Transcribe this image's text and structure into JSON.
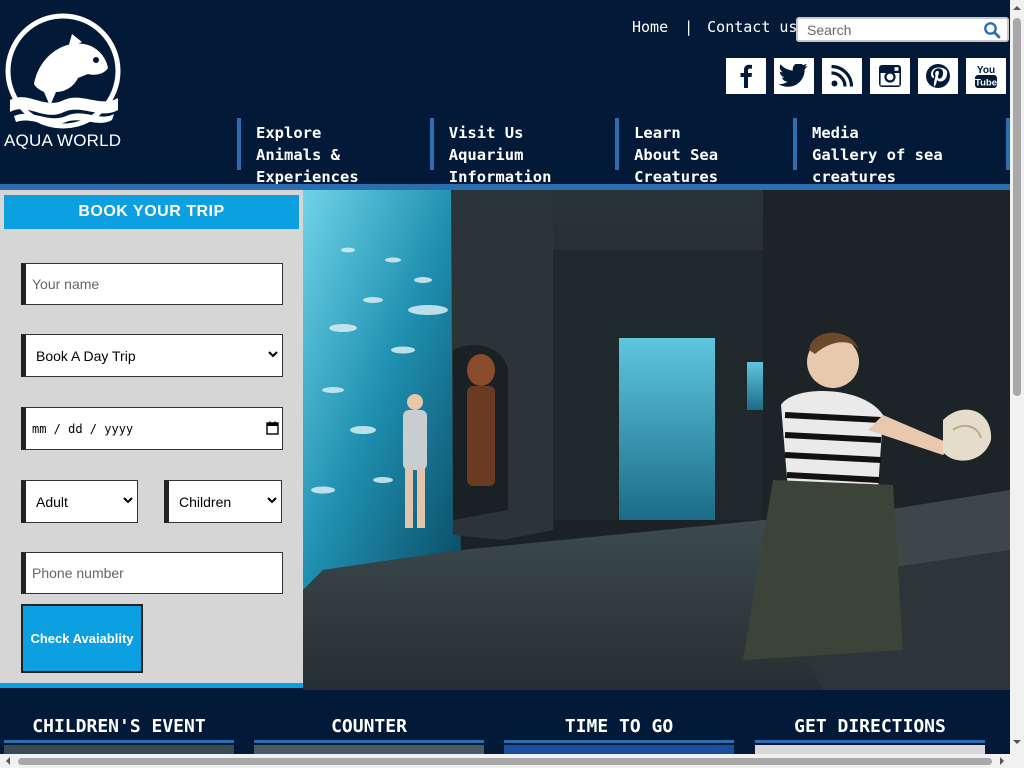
{
  "brand": {
    "name": "AQUA WORLD"
  },
  "toplinks": {
    "home": "Home",
    "separator": "|",
    "contact": "Contact us"
  },
  "search": {
    "placeholder": "Search",
    "icon": "search-icon"
  },
  "social": [
    "facebook-icon",
    "twitter-icon",
    "rss-icon",
    "instagram-icon",
    "pinterest-icon",
    "youtube-icon"
  ],
  "nav": [
    {
      "line1": "Explore",
      "line2": "Animals & Experiences"
    },
    {
      "line1": "Visit Us",
      "line2": "Aquarium Information"
    },
    {
      "line1": "Learn",
      "line2": "About Sea Creatures"
    },
    {
      "line1": "Media",
      "line2": "Gallery of sea creatures"
    }
  ],
  "booking": {
    "title": "BOOK YOUR TRIP",
    "name_placeholder": "Your name",
    "trip_selected": "Book A Day Trip",
    "date_placeholder": "mm / dd / yyyy",
    "adult_selected": "Adult",
    "children_selected": "Children",
    "phone_placeholder": "Phone number",
    "submit_label": "Check Avaiablity"
  },
  "cards": [
    {
      "title": "CHILDREN'S EVENT"
    },
    {
      "title": "COUNTER"
    },
    {
      "title": "TIME TO GO"
    },
    {
      "title": "GET DIRECTIONS"
    }
  ],
  "colors": {
    "navy": "#021a38",
    "accent": "#0ca0e0",
    "navline": "#2b6fb2"
  }
}
